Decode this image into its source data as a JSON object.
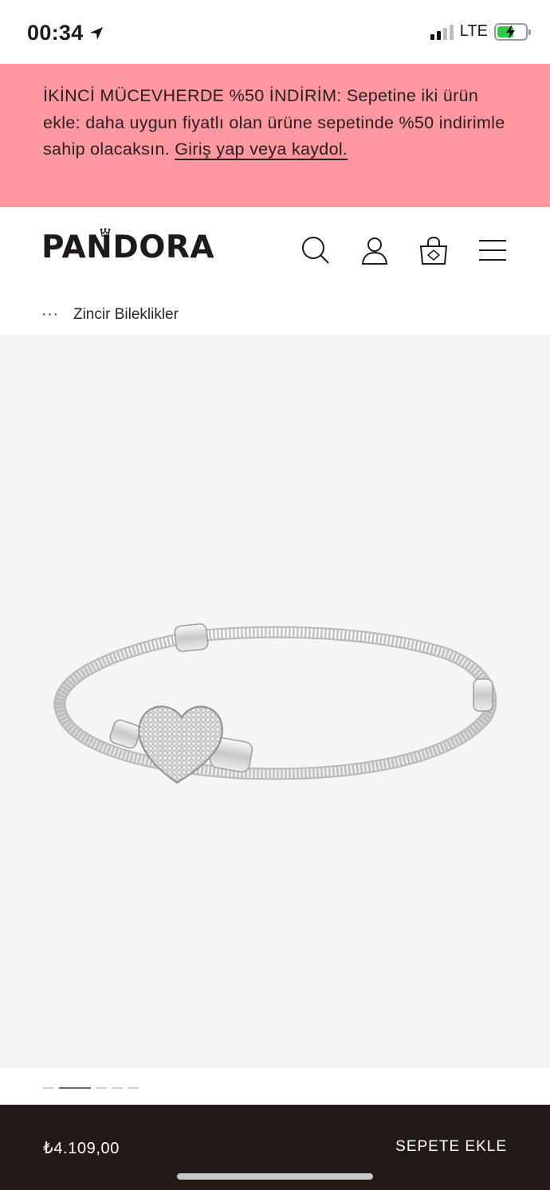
{
  "status_bar": {
    "time": "00:34",
    "network": "LTE",
    "battery_level": 0.6,
    "battery_color": "#36c64a"
  },
  "promo": {
    "text": "İKİNCİ MÜCEVHERDE %50 İNDİRİM: Sepetine iki ürün ekle: daha uygun fiyatlı olan ürüne sepetinde %50 indirimle sahip olacaksın.",
    "link_text": "Giriş yap veya kaydol.",
    "background": "#ff98a1"
  },
  "header": {
    "logo": "PANDORA",
    "icons": [
      "search-icon",
      "account-icon",
      "shopping-bag-icon",
      "menu-icon"
    ]
  },
  "breadcrumb": {
    "ellipsis": "···",
    "current": "Zincir Bileklikler"
  },
  "product": {
    "image": "bracelet-image",
    "carousel_total": 5,
    "carousel_active": 2
  },
  "bottom_bar": {
    "price": "₺4.109,00",
    "add_to_cart": "SEPETE EKLE",
    "background": "#221a17"
  }
}
